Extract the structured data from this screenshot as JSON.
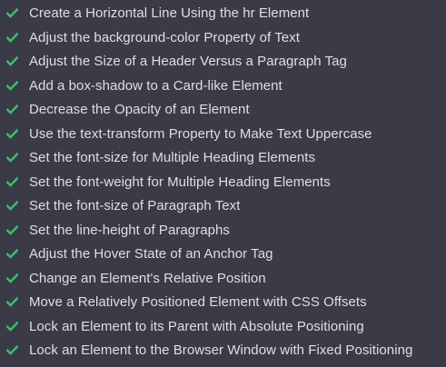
{
  "colors": {
    "background": "#3b3b48",
    "text": "#dfdfe2",
    "check": "#3bc16f"
  },
  "icons": {
    "completed": "check-icon"
  },
  "challenges": [
    {
      "title": "Create a Horizontal Line Using the hr Element",
      "completed": true
    },
    {
      "title": "Adjust the background-color Property of Text",
      "completed": true
    },
    {
      "title": "Adjust the Size of a Header Versus a Paragraph Tag",
      "completed": true
    },
    {
      "title": "Add a box-shadow to a Card-like Element",
      "completed": true
    },
    {
      "title": "Decrease the Opacity of an Element",
      "completed": true
    },
    {
      "title": "Use the text-transform Property to Make Text Uppercase",
      "completed": true
    },
    {
      "title": "Set the font-size for Multiple Heading Elements",
      "completed": true
    },
    {
      "title": "Set the font-weight for Multiple Heading Elements",
      "completed": true
    },
    {
      "title": "Set the font-size of Paragraph Text",
      "completed": true
    },
    {
      "title": "Set the line-height of Paragraphs",
      "completed": true
    },
    {
      "title": "Adjust the Hover State of an Anchor Tag",
      "completed": true
    },
    {
      "title": "Change an Element's Relative Position",
      "completed": true
    },
    {
      "title": "Move a Relatively Positioned Element with CSS Offsets",
      "completed": true
    },
    {
      "title": "Lock an Element to its Parent with Absolute Positioning",
      "completed": true
    },
    {
      "title": "Lock an Element to the Browser Window with Fixed Positioning",
      "completed": true
    }
  ]
}
